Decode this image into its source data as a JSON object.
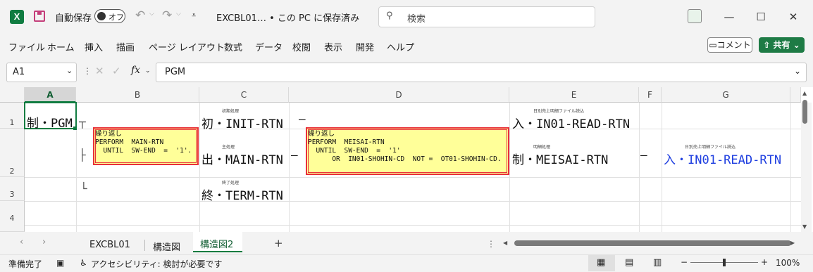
{
  "titlebar": {
    "autosave_label": "自動保存",
    "autosave_state": "オフ",
    "doc_title": "EXCBL01… • この PC に保存済み",
    "search_placeholder": "検索"
  },
  "menu": [
    "ファイル",
    "ホーム",
    "挿入",
    "描画",
    "ページ レイアウト",
    "数式",
    "データ",
    "校閲",
    "表示",
    "開発",
    "ヘルプ"
  ],
  "buttons": {
    "comment": "コメント",
    "share": "共有"
  },
  "formula_bar": {
    "name_box": "A1",
    "fx": "fx",
    "content": "PGM"
  },
  "columns": [
    "A",
    "B",
    "C",
    "D",
    "E",
    "F",
    "G"
  ],
  "rows": [
    "1",
    "2",
    "3",
    "4"
  ],
  "cells": {
    "a1": "制・PGM",
    "c1_small": "初期処理",
    "c1": "初・INIT-RTN",
    "e1_small": "日別売上明細ファイル読込",
    "e1": "入・IN01-READ-RTN",
    "c2_small": "主処理",
    "c2": "出・MAIN-RTN",
    "e2_small": "明細処理",
    "e2": "制・MEISAI-RTN",
    "g2_small": "日別売上明細ファイル読込",
    "g2": "入・IN01-READ-RTN",
    "c3_small": "終了処理",
    "c3": "終・TERM-RTN",
    "connector_b1": "┬",
    "connector_b2": "├",
    "connector_b3": "└",
    "dash_d1": "—",
    "dash_d2": "—",
    "dash_f2": "—"
  },
  "notes": {
    "b": "繰り返し\nPERFORM  MAIN-RTN\n  UNTIL  SW-END  =  '1'.",
    "d": "繰り返し\nPERFORM  MEISAI-RTN\n  UNTIL  SW-END  =  '1'\n      OR  IN01-SHOHIN-CD  NOT =  OT01-SHOHIN-CD."
  },
  "sheets": {
    "tabs": [
      "EXCBL01",
      "構造図",
      "構造図2"
    ],
    "active": "構造図2"
  },
  "status": {
    "ready": "準備完了",
    "accessibility": "アクセシビリティ: 検討が必要です",
    "zoom": "100%"
  },
  "colors": {
    "excel_green": "#107c41",
    "note_fill": "#ffff99",
    "note_border": "#e8303a",
    "link_blue": "#1f3fe0"
  }
}
